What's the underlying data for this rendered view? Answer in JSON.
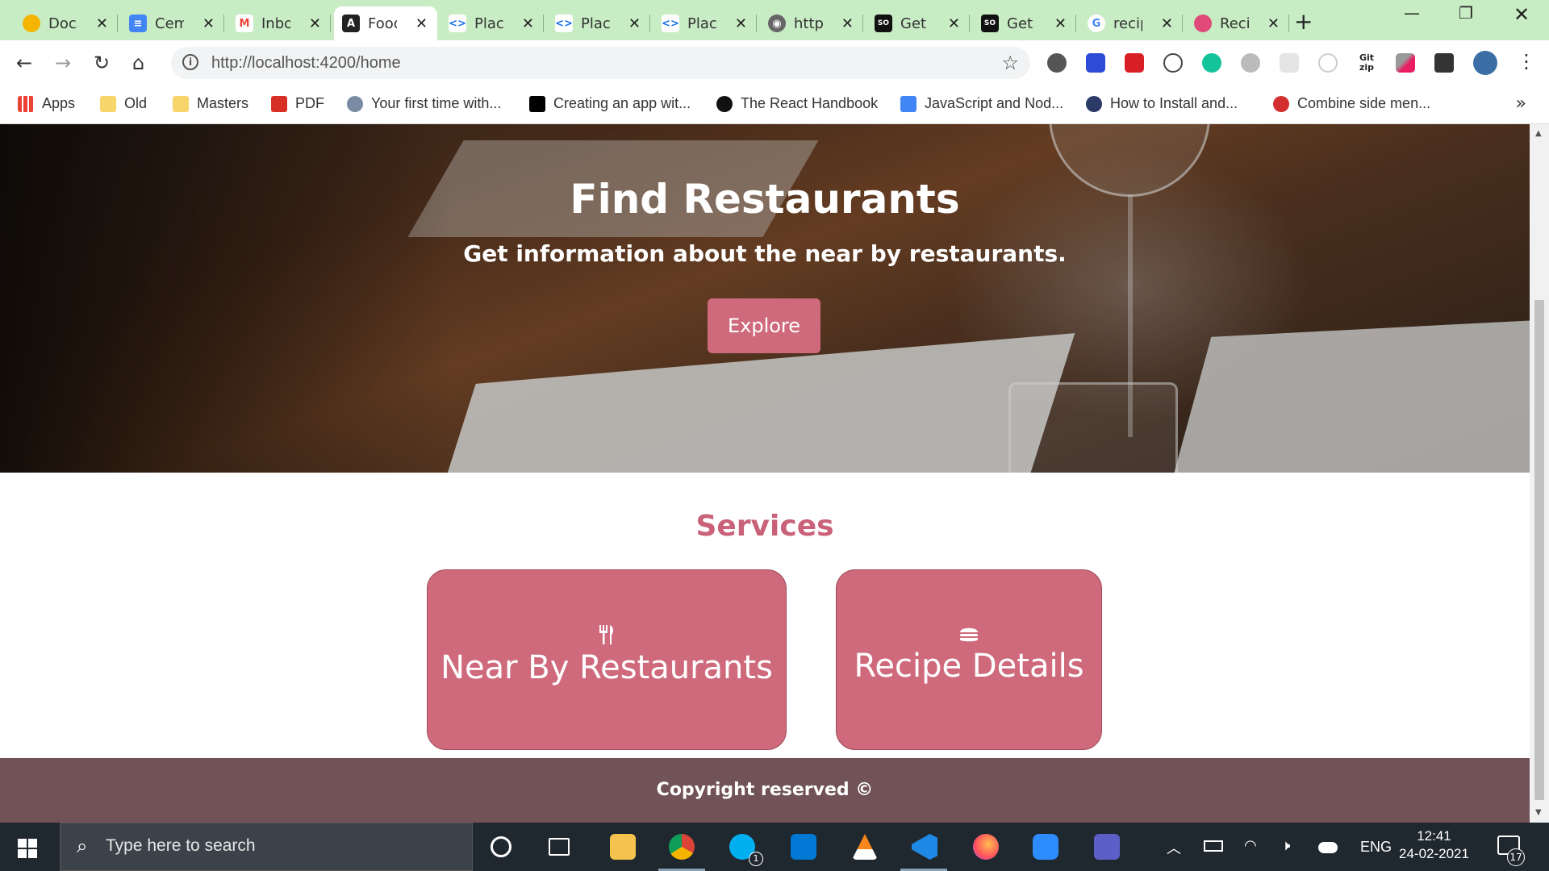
{
  "browser": {
    "tabs": [
      {
        "label": "Docs",
        "favicon": "docs-circle-icon",
        "color": "#f4b400"
      },
      {
        "label": "Cem",
        "favicon": "google-docs-icon",
        "color": "#4285f4"
      },
      {
        "label": "Inbox",
        "favicon": "gmail-icon",
        "color": "#ea4335"
      },
      {
        "label": "Food",
        "favicon": "angular-icon",
        "color": "#222222",
        "active": true
      },
      {
        "label": "Place",
        "favicon": "code-icon",
        "color": "#1a73e8"
      },
      {
        "label": "Place",
        "favicon": "code-icon",
        "color": "#1a73e8"
      },
      {
        "label": "Place",
        "favicon": "code-icon",
        "color": "#1a73e8"
      },
      {
        "label": "http",
        "favicon": "globe-icon",
        "color": "#555555"
      },
      {
        "label": "Get",
        "favicon": "stackoverflow-icon",
        "color": "#111111"
      },
      {
        "label": "Get",
        "favicon": "stackoverflow-icon",
        "color": "#111111"
      },
      {
        "label": "recip",
        "favicon": "google-icon",
        "color": "#4285f4"
      },
      {
        "label": "Reci",
        "favicon": "dribbble-icon",
        "color": "#e04a7a"
      }
    ],
    "address_bar": {
      "url": "http://localhost:4200/home"
    },
    "bookmarks": [
      {
        "label": "Apps",
        "icon": "apps-grid-icon"
      },
      {
        "label": "Old",
        "icon": "folder-icon"
      },
      {
        "label": "Masters",
        "icon": "folder-icon"
      },
      {
        "label": "PDF",
        "icon": "pdf-icon"
      },
      {
        "label": "Your first time with...",
        "icon": "site-icon"
      },
      {
        "label": "Creating an app wit...",
        "icon": "dev-icon"
      },
      {
        "label": "The React Handbook",
        "icon": "react-handbook-icon"
      },
      {
        "label": "JavaScript and Nod...",
        "icon": "google-docs-icon"
      },
      {
        "label": "How to Install and...",
        "icon": "electron-icon"
      },
      {
        "label": "Combine side men...",
        "icon": "site-icon"
      }
    ],
    "extensions": [
      "extension-circle-icon",
      "zotero-icon",
      "acrobat-icon",
      "json-icon",
      "grammarly-icon",
      "extension-icon",
      "extension-icon",
      "extension-icon",
      "gitzip-icon",
      "eyedropper-icon",
      "puzzle-icon",
      "profile-avatar-icon",
      "menu-icon"
    ]
  },
  "page": {
    "hero": {
      "title": "Find Restaurants",
      "subtitle": "Get information about the near by restaurants.",
      "button": "Explore"
    },
    "services": {
      "title": "Services",
      "cards": [
        {
          "label": "Near By Restaurants",
          "icon": "utensils-icon"
        },
        {
          "label": "Recipe Details",
          "icon": "hamburger-icon"
        }
      ]
    },
    "footer": {
      "text": "Copyright reserved ©"
    }
  },
  "colors": {
    "accent": "#cf6a7c",
    "services_title": "#c96178",
    "footer_bg": "#705257",
    "tabstrip": "#c8ecc4"
  },
  "taskbar": {
    "search_placeholder": "Type here to search",
    "language": "ENG",
    "time": "12:41",
    "date": "24-02-2021",
    "notification_count": "17",
    "skype_badge": "1"
  }
}
